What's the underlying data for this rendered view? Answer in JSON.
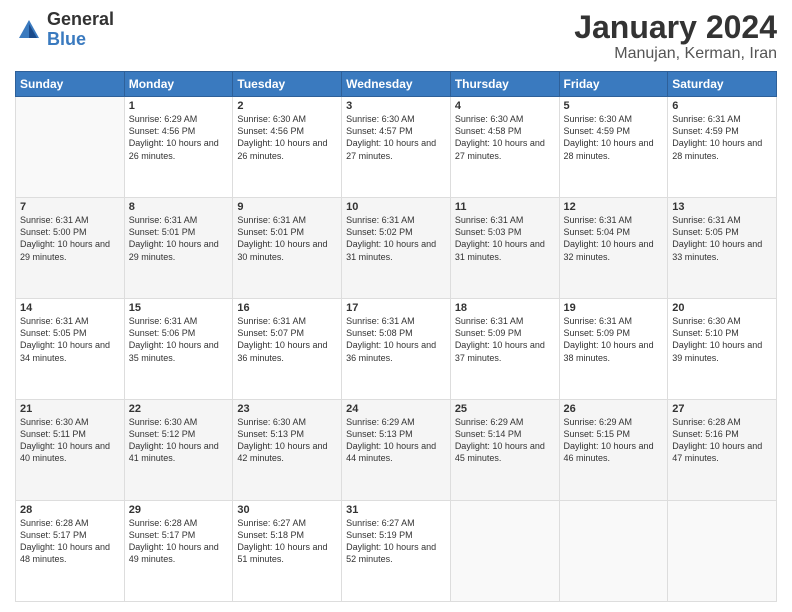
{
  "logo": {
    "general": "General",
    "blue": "Blue"
  },
  "title": "January 2024",
  "subtitle": "Manujan, Kerman, Iran",
  "days_header": [
    "Sunday",
    "Monday",
    "Tuesday",
    "Wednesday",
    "Thursday",
    "Friday",
    "Saturday"
  ],
  "weeks": [
    [
      {
        "day": "",
        "info": ""
      },
      {
        "day": "1",
        "info": "Sunrise: 6:29 AM\nSunset: 4:56 PM\nDaylight: 10 hours\nand 26 minutes."
      },
      {
        "day": "2",
        "info": "Sunrise: 6:30 AM\nSunset: 4:56 PM\nDaylight: 10 hours\nand 26 minutes."
      },
      {
        "day": "3",
        "info": "Sunrise: 6:30 AM\nSunset: 4:57 PM\nDaylight: 10 hours\nand 27 minutes."
      },
      {
        "day": "4",
        "info": "Sunrise: 6:30 AM\nSunset: 4:58 PM\nDaylight: 10 hours\nand 27 minutes."
      },
      {
        "day": "5",
        "info": "Sunrise: 6:30 AM\nSunset: 4:59 PM\nDaylight: 10 hours\nand 28 minutes."
      },
      {
        "day": "6",
        "info": "Sunrise: 6:31 AM\nSunset: 4:59 PM\nDaylight: 10 hours\nand 28 minutes."
      }
    ],
    [
      {
        "day": "7",
        "info": "Sunrise: 6:31 AM\nSunset: 5:00 PM\nDaylight: 10 hours\nand 29 minutes."
      },
      {
        "day": "8",
        "info": "Sunrise: 6:31 AM\nSunset: 5:01 PM\nDaylight: 10 hours\nand 29 minutes."
      },
      {
        "day": "9",
        "info": "Sunrise: 6:31 AM\nSunset: 5:01 PM\nDaylight: 10 hours\nand 30 minutes."
      },
      {
        "day": "10",
        "info": "Sunrise: 6:31 AM\nSunset: 5:02 PM\nDaylight: 10 hours\nand 31 minutes."
      },
      {
        "day": "11",
        "info": "Sunrise: 6:31 AM\nSunset: 5:03 PM\nDaylight: 10 hours\nand 31 minutes."
      },
      {
        "day": "12",
        "info": "Sunrise: 6:31 AM\nSunset: 5:04 PM\nDaylight: 10 hours\nand 32 minutes."
      },
      {
        "day": "13",
        "info": "Sunrise: 6:31 AM\nSunset: 5:05 PM\nDaylight: 10 hours\nand 33 minutes."
      }
    ],
    [
      {
        "day": "14",
        "info": "Sunrise: 6:31 AM\nSunset: 5:05 PM\nDaylight: 10 hours\nand 34 minutes."
      },
      {
        "day": "15",
        "info": "Sunrise: 6:31 AM\nSunset: 5:06 PM\nDaylight: 10 hours\nand 35 minutes."
      },
      {
        "day": "16",
        "info": "Sunrise: 6:31 AM\nSunset: 5:07 PM\nDaylight: 10 hours\nand 36 minutes."
      },
      {
        "day": "17",
        "info": "Sunrise: 6:31 AM\nSunset: 5:08 PM\nDaylight: 10 hours\nand 36 minutes."
      },
      {
        "day": "18",
        "info": "Sunrise: 6:31 AM\nSunset: 5:09 PM\nDaylight: 10 hours\nand 37 minutes."
      },
      {
        "day": "19",
        "info": "Sunrise: 6:31 AM\nSunset: 5:09 PM\nDaylight: 10 hours\nand 38 minutes."
      },
      {
        "day": "20",
        "info": "Sunrise: 6:30 AM\nSunset: 5:10 PM\nDaylight: 10 hours\nand 39 minutes."
      }
    ],
    [
      {
        "day": "21",
        "info": "Sunrise: 6:30 AM\nSunset: 5:11 PM\nDaylight: 10 hours\nand 40 minutes."
      },
      {
        "day": "22",
        "info": "Sunrise: 6:30 AM\nSunset: 5:12 PM\nDaylight: 10 hours\nand 41 minutes."
      },
      {
        "day": "23",
        "info": "Sunrise: 6:30 AM\nSunset: 5:13 PM\nDaylight: 10 hours\nand 42 minutes."
      },
      {
        "day": "24",
        "info": "Sunrise: 6:29 AM\nSunset: 5:13 PM\nDaylight: 10 hours\nand 44 minutes."
      },
      {
        "day": "25",
        "info": "Sunrise: 6:29 AM\nSunset: 5:14 PM\nDaylight: 10 hours\nand 45 minutes."
      },
      {
        "day": "26",
        "info": "Sunrise: 6:29 AM\nSunset: 5:15 PM\nDaylight: 10 hours\nand 46 minutes."
      },
      {
        "day": "27",
        "info": "Sunrise: 6:28 AM\nSunset: 5:16 PM\nDaylight: 10 hours\nand 47 minutes."
      }
    ],
    [
      {
        "day": "28",
        "info": "Sunrise: 6:28 AM\nSunset: 5:17 PM\nDaylight: 10 hours\nand 48 minutes."
      },
      {
        "day": "29",
        "info": "Sunrise: 6:28 AM\nSunset: 5:17 PM\nDaylight: 10 hours\nand 49 minutes."
      },
      {
        "day": "30",
        "info": "Sunrise: 6:27 AM\nSunset: 5:18 PM\nDaylight: 10 hours\nand 51 minutes."
      },
      {
        "day": "31",
        "info": "Sunrise: 6:27 AM\nSunset: 5:19 PM\nDaylight: 10 hours\nand 52 minutes."
      },
      {
        "day": "",
        "info": ""
      },
      {
        "day": "",
        "info": ""
      },
      {
        "day": "",
        "info": ""
      }
    ]
  ]
}
